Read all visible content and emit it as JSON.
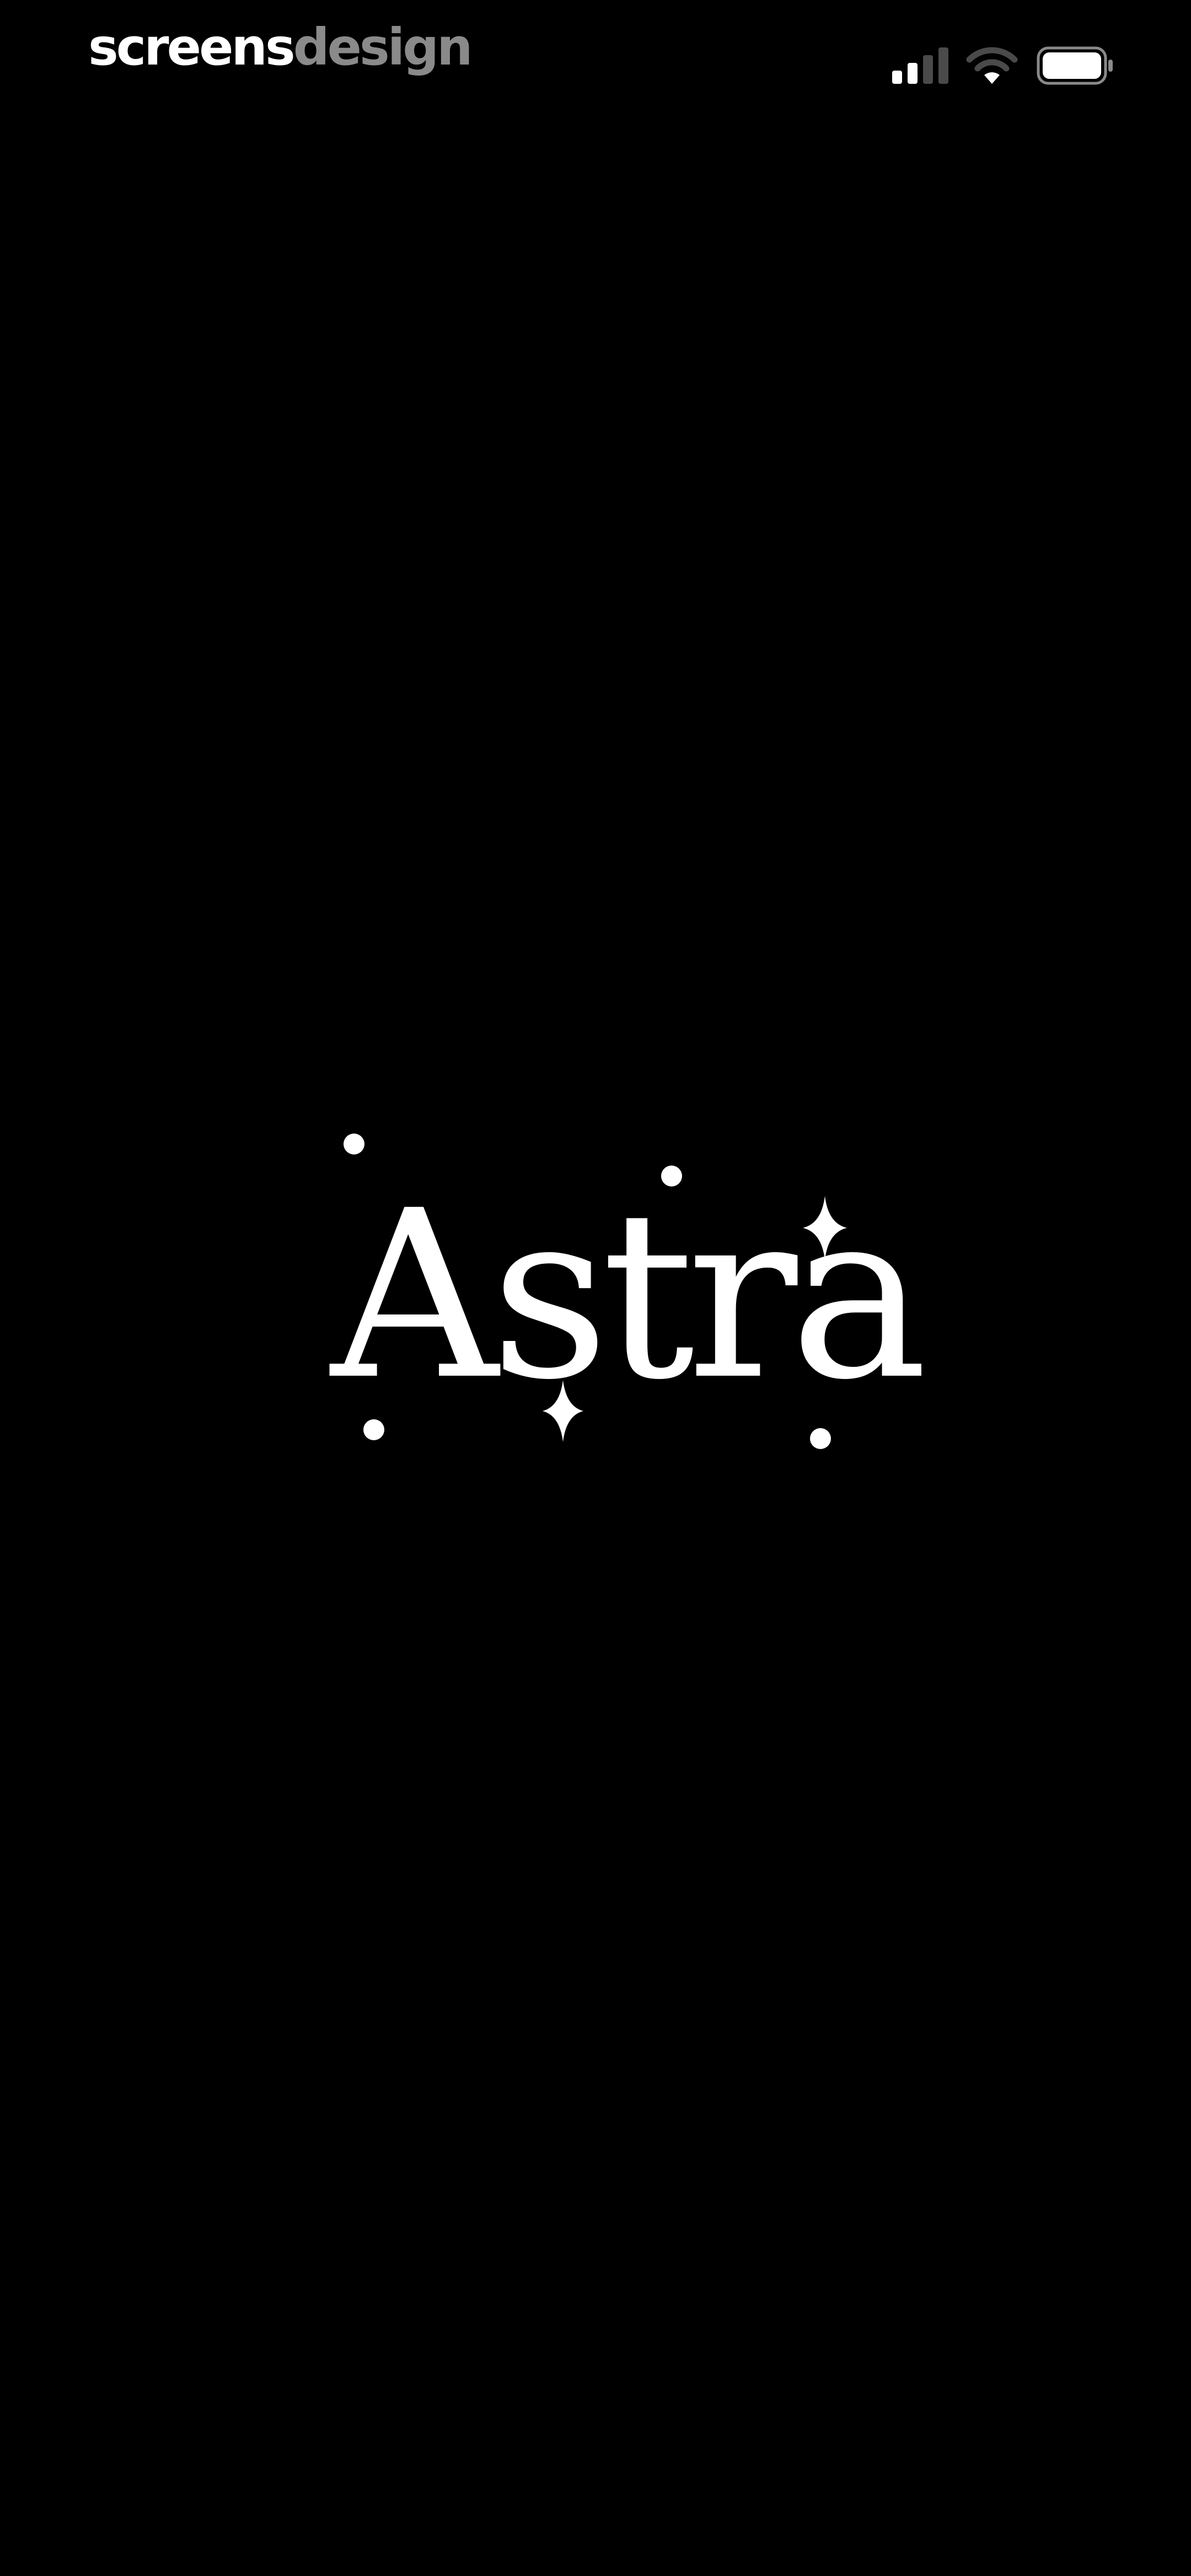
{
  "status_bar": {
    "watermark_part1": "screens",
    "watermark_part2": "design",
    "icons": [
      "signal-icon",
      "wifi-icon",
      "battery-icon"
    ]
  },
  "splash": {
    "app_name": "Astra",
    "decorations": [
      "sparkle-icon",
      "dot-icon"
    ]
  },
  "colors": {
    "background": "#000000",
    "foreground": "#ffffff",
    "watermark_muted": "#8a8a8a"
  }
}
